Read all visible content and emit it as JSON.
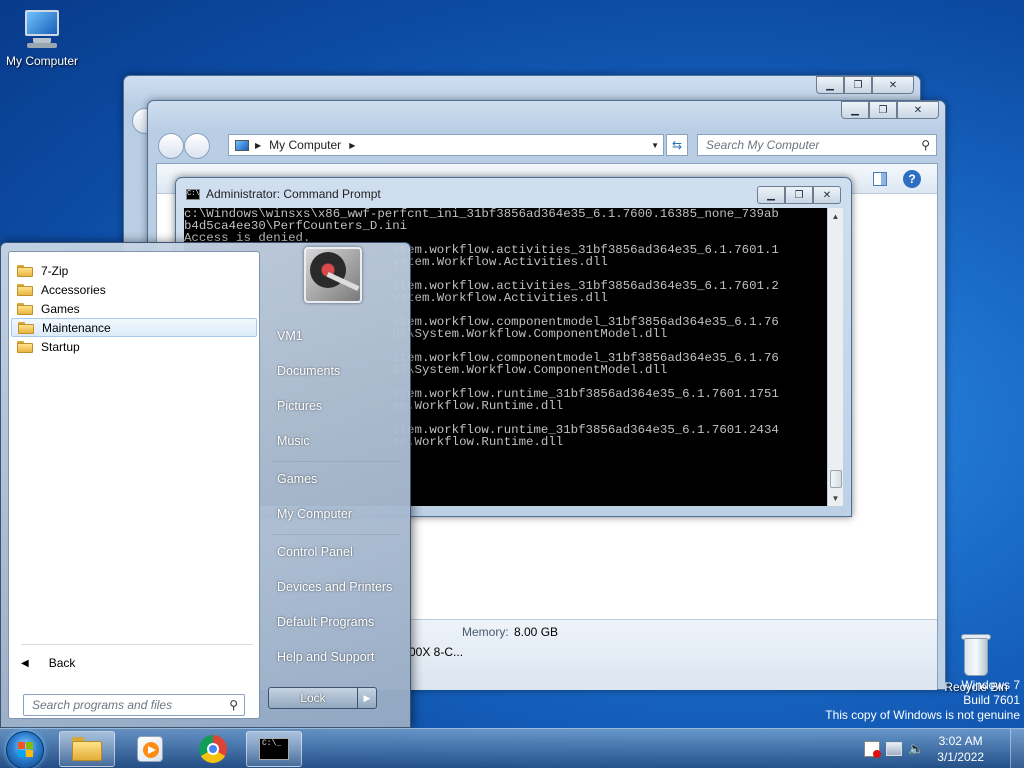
{
  "desktop": {
    "icons": {
      "my_computer": "My Computer",
      "recycle_bin": "Recycle Bin"
    },
    "watermark": {
      "line1": "Windows 7",
      "line2": "Build 7601",
      "line3": "This copy of Windows is not genuine"
    }
  },
  "explorer": {
    "address_location": "My Computer",
    "search_placeholder": "Search My Computer",
    "memory_label": "Memory:",
    "memory_value": "8.00 GB",
    "processor_fragment": "00X 8-C..."
  },
  "cmd": {
    "title": "Administrator: Command Prompt",
    "lines": [
      "c:\\Windows\\winsxs\\x86_wwf-perfcnt_ini_31bf3856ad364e35_6.1.7600.16385_none_739ab",
      "b4d5ca4ee30\\PerfCounters_D.ini",
      "Access is denied.",
      "                            stem.workflow.activities_31bf3856ad364e35_6.1.7601.1",
      "                            ystem.Workflow.Activities.dll",
      "",
      "                            stem.workflow.activities_31bf3856ad364e35_6.1.7601.2",
      "                            ystem.Workflow.Activities.dll",
      "",
      "                            stem.workflow.componentmodel_31bf3856ad364e35_6.1.76",
      "                            d5\\System.Workflow.ComponentModel.dll",
      "",
      "                            stem.workflow.componentmodel_31bf3856ad364e35_6.1.76",
      "                            37\\System.Workflow.ComponentModel.dll",
      "",
      "                            stem.workflow.runtime_31bf3856ad364e35_6.1.7601.1751",
      "                            em.Workflow.Runtime.dll",
      "",
      "                            stem.workflow.runtime_31bf3856ad364e35_6.1.7601.2434",
      "                            em.Workflow.Runtime.dll"
    ]
  },
  "start_menu": {
    "programs": [
      "7-Zip",
      "Accessories",
      "Games",
      "Maintenance",
      "Startup"
    ],
    "hovered_program": "Maintenance",
    "back_label": "Back",
    "search_placeholder": "Search programs and files",
    "right_items": {
      "user": "VM1",
      "documents": "Documents",
      "pictures": "Pictures",
      "music": "Music",
      "games": "Games",
      "computer": "My Computer",
      "control_panel": "Control Panel",
      "devices": "Devices and Printers",
      "default_programs": "Default Programs",
      "help": "Help and Support"
    },
    "lock_label": "Lock"
  },
  "taskbar": {
    "pinned": [
      "start-orb",
      "explorer-icon",
      "media-player-icon",
      "chrome-icon",
      "cmd-icon"
    ],
    "active_button": "explorer-icon",
    "clock_time": "3:02 AM",
    "clock_date": "3/1/2022"
  },
  "colors": {
    "desktop_bg": "#1a6bc8",
    "cmd_bg": "#000000",
    "cmd_text": "#c0c0c0",
    "hover_highlight": "#dcebfa"
  }
}
